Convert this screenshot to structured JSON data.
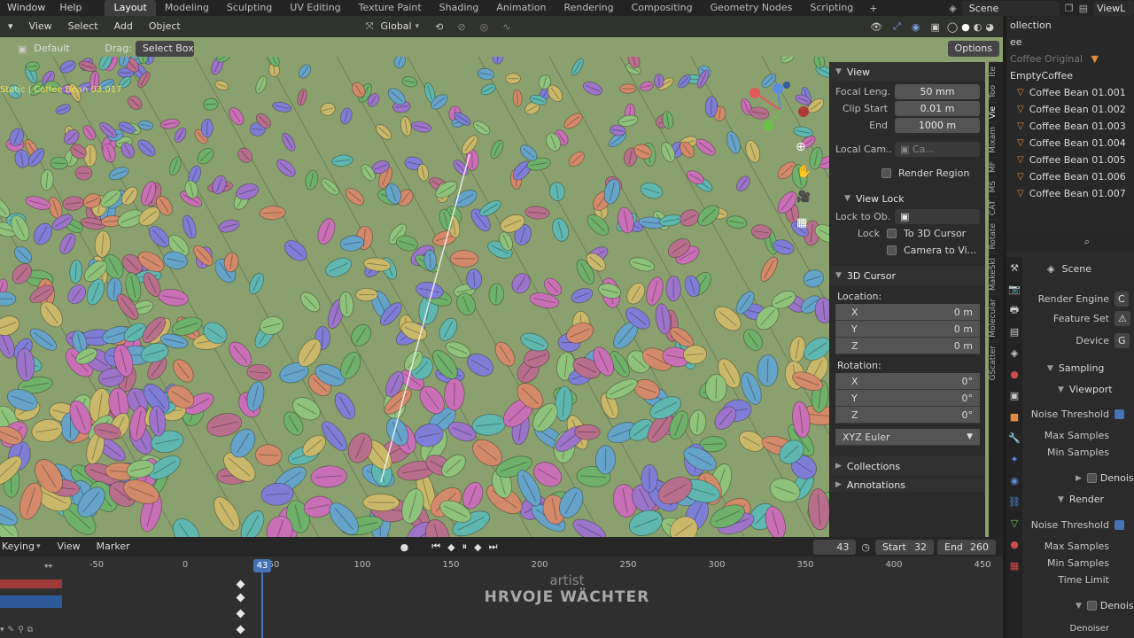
{
  "topbar": {
    "menus": [
      "Window",
      "Help"
    ],
    "workspaces": [
      "Layout",
      "Modeling",
      "Sculpting",
      "UV Editing",
      "Texture Paint",
      "Shading",
      "Animation",
      "Rendering",
      "Compositing",
      "Geometry Nodes",
      "Scripting"
    ],
    "active_workspace": "Layout",
    "add_symbol": "+",
    "scene": "Scene",
    "viewlayer": "ViewL"
  },
  "viewport": {
    "menus": [
      "View",
      "Select",
      "Add",
      "Object"
    ],
    "orientation": "Global",
    "orientation_label": "Default",
    "drag_label": "Drag:",
    "drag_value": "Select Box",
    "options_label": "Options",
    "object_info": "Static | Coffee Bean 03.017",
    "bg_color": "#8aa06e"
  },
  "npanel": {
    "view_title": "View",
    "focal_label": "Focal Leng...",
    "focal_value": "50 mm",
    "clip_start_label": "Clip Start",
    "clip_start_value": "0.01 m",
    "end_label": "End",
    "end_value": "1000 m",
    "local_cam_label": "Local Cam...",
    "local_cam_value": "Ca...",
    "render_region": "Render Region",
    "view_lock_title": "View Lock",
    "lock_to_obj_label": "Lock to Ob...",
    "lock_label": "Lock",
    "to_cursor": "To 3D Cursor",
    "camera_to_view": "Camera to Vi...",
    "cursor_title": "3D Cursor",
    "location_label": "Location:",
    "loc": [
      {
        "axis": "X",
        "value": "0 m"
      },
      {
        "axis": "Y",
        "value": "0 m"
      },
      {
        "axis": "Z",
        "value": "0 m"
      }
    ],
    "rotation_label": "Rotation:",
    "rot": [
      {
        "axis": "X",
        "value": "0°"
      },
      {
        "axis": "Y",
        "value": "0°"
      },
      {
        "axis": "Z",
        "value": "0°"
      }
    ],
    "rotation_mode": "XYZ Euler",
    "collections": "Collections",
    "annotations": "Annotations"
  },
  "vtabs": [
    "Ite",
    "Too",
    "Vie",
    "Mixam",
    "MF",
    "MS",
    "CAT",
    "Rotate",
    "MakeSkl",
    "Molecular",
    "GScatter"
  ],
  "outliner": {
    "header": "ollection",
    "items": [
      "ee",
      "Coffee Original",
      "EmptyCoffee",
      "Coffee Bean 01.001",
      "Coffee Bean 01.002",
      "Coffee Bean 01.003",
      "Coffee Bean 01.004",
      "Coffee Bean 01.005",
      "Coffee Bean 01.006",
      "Coffee Bean 01.007"
    ]
  },
  "props": {
    "scene_label": "Scene",
    "render_engine": "Render Engine",
    "feature_set": "Feature Set",
    "device": "Device",
    "sampling": "Sampling",
    "viewport": "Viewport",
    "noise_threshold": "Noise Threshold",
    "max_samples": "Max Samples",
    "min_samples": "Min Samples",
    "denoise": "Denoise",
    "render": "Render",
    "noise_threshold2": "Noise Threshold",
    "max_samples2": "Max Samples",
    "min_samples2": "Min Samples",
    "time_limit": "Time Limit",
    "denoise2": "Denoise",
    "denoiser": "Denoiser"
  },
  "timeline": {
    "keying": "Keying",
    "view": "View",
    "marker": "Marker",
    "current_frame": "43",
    "playhead_label": "43",
    "start_label": "Start",
    "start": "32",
    "end_label": "End",
    "end": "260",
    "ticks": [
      "-50",
      "0",
      "50",
      "100",
      "150",
      "200",
      "250",
      "300",
      "350",
      "400",
      "450"
    ]
  },
  "watermark": {
    "artist": "artist",
    "name": "HRVOJE WÄCHTER"
  }
}
